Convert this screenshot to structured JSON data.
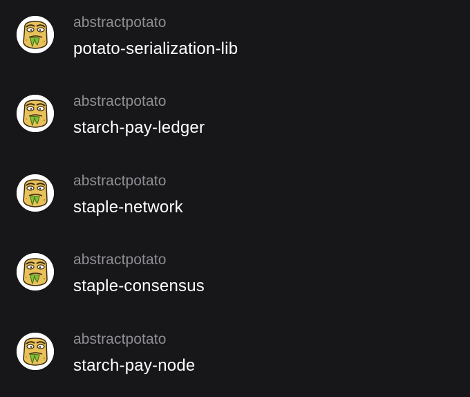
{
  "repos": [
    {
      "owner": "abstractpotato",
      "name": "potato-serialization-lib"
    },
    {
      "owner": "abstractpotato",
      "name": "starch-pay-ledger"
    },
    {
      "owner": "abstractpotato",
      "name": "staple-network"
    },
    {
      "owner": "abstractpotato",
      "name": "staple-consensus"
    },
    {
      "owner": "abstractpotato",
      "name": "starch-pay-node"
    }
  ],
  "colors": {
    "background": "#17171a",
    "owner_text": "#8e8e93",
    "repo_text": "#ffffff",
    "avatar_potato": "#e8c15a",
    "avatar_slime": "#7fbf3a"
  },
  "avatar_icon": "potato-avatar-icon"
}
